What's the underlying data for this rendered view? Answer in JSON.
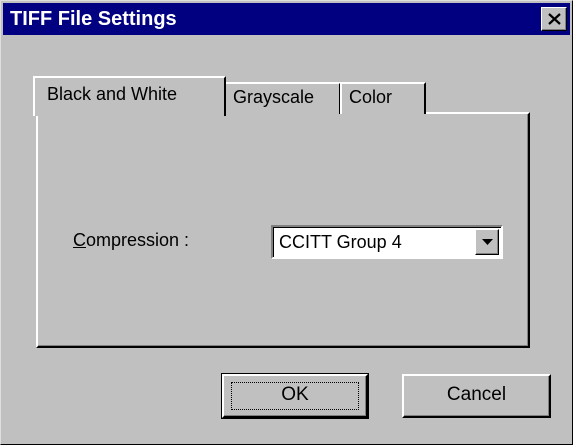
{
  "window": {
    "title": "TIFF File Settings",
    "close_icon": "close-icon"
  },
  "tabs": [
    {
      "label": "Black and White",
      "selected": true
    },
    {
      "label": "Grayscale",
      "selected": false
    },
    {
      "label": "Color",
      "selected": false
    }
  ],
  "compression": {
    "label_mnemonic": "C",
    "label_rest": "ompression :",
    "value": "CCITT Group 4",
    "dropdown_icon": "chevron-down-icon"
  },
  "buttons": {
    "ok_label": "OK",
    "cancel_label": "Cancel"
  },
  "colors": {
    "titlebar": "#000080",
    "face": "#c0c0c0",
    "highlight": "#ffffff",
    "shadow": "#808080"
  }
}
